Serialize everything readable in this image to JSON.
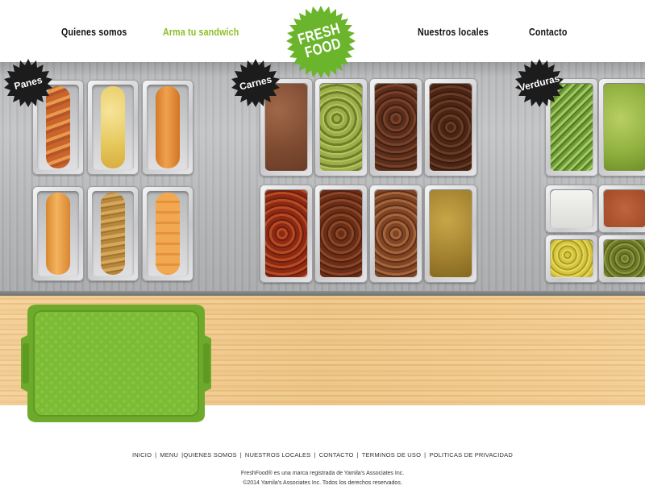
{
  "nav": {
    "items": [
      {
        "label": "Quienes somos",
        "active": false
      },
      {
        "label": "Arma tu sandwich",
        "active": true
      },
      {
        "label": "Nuestros locales",
        "active": false
      },
      {
        "label": "Contacto",
        "active": false
      }
    ],
    "logo": {
      "line1": "FRESH",
      "line2": "FOOD",
      "color": "#6bb52c"
    }
  },
  "sections": {
    "panes": "Panes",
    "carnes": "Carnes",
    "verduras": "Verduras"
  },
  "colors": {
    "accent": "#8cbf26",
    "tray": "#7cbb35",
    "badge": "#1c1c1c"
  },
  "footer": {
    "links": [
      "INICIO",
      "MENU",
      "QUIENES SOMOS",
      "NUESTROS LOCALES",
      "CONTACTO",
      "TERMINOS DE USO",
      "POLITICAS DE PRIVACIDAD"
    ],
    "trademark": "FreshFood® es una marca registrada de Yamila's Associates Inc.",
    "copyright": "©2014 Yamila's Associates Inc. Todos los derechos reservados."
  }
}
